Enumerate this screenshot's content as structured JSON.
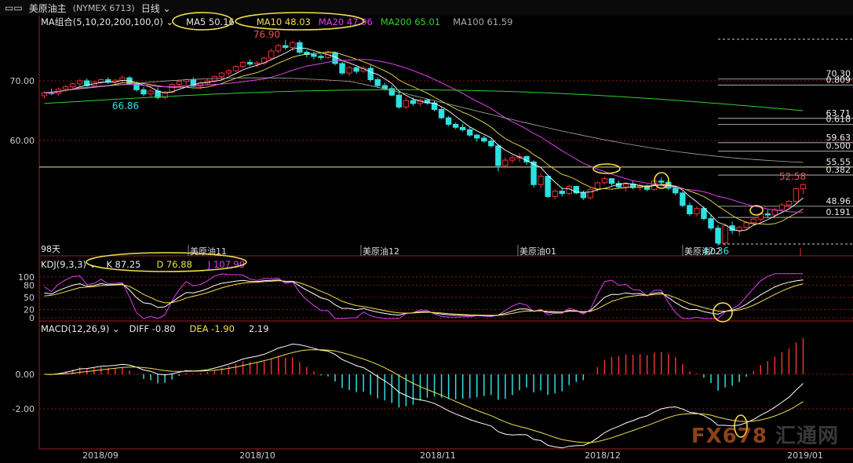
{
  "title": {
    "left_icon": "window-controls-icon",
    "name": "美原油主",
    "symbol": "(NYMEX 6713)",
    "period": "日线"
  },
  "ma": {
    "label": "MA组合(5,10,20,200,100,0)",
    "ma5": "MA5 50.16",
    "ma10": "MA10 48.03",
    "ma20": "MA20 47.96",
    "ma200": "MA200 65.01",
    "ma100": "MA100 61.59"
  },
  "kdj": {
    "label": "KDJ(9,3,3)",
    "k": "K 87.25",
    "d": "D 76.88",
    "j": "J 107.99",
    "ticks": [
      "100",
      "80",
      "50",
      "20",
      "0"
    ]
  },
  "macd": {
    "label": "MACD(12,26,9)",
    "diff": "DIFF -0.80",
    "dea": "DEA -1.90",
    "macd": "2.19",
    "ticks": [
      "0.00",
      "-2.00"
    ]
  },
  "price_axis": [
    "70.00",
    "60.00"
  ],
  "fib_labels": [
    {
      "label": "70.30",
      "value": 70.3
    },
    {
      "label": "0.809",
      "value": 69.3
    },
    {
      "label": "63.71",
      "value": 63.71
    },
    {
      "label": "0.618",
      "value": 62.7
    },
    {
      "label": "59.63",
      "value": 59.63
    },
    {
      "label": "0.500",
      "value": 58.2
    },
    {
      "label": "55.55",
      "value": 55.55
    },
    {
      "label": "0.382",
      "value": 54.2
    },
    {
      "label": "48.96",
      "value": 48.96
    },
    {
      "label": "0.191",
      "value": 47.1
    }
  ],
  "annotations": {
    "high": "76.90",
    "low1": "66.86",
    "last": "52.58",
    "low2": "42.36",
    "days": "98天"
  },
  "contract_labels": [
    "美原油11",
    "美原油12",
    "美原油01",
    "美原油02"
  ],
  "x_labels": [
    "2018/09",
    "2018/10",
    "2018/11",
    "2018/12",
    "2019/01"
  ],
  "watermark": {
    "a": "FX678",
    "b": "汇通网"
  },
  "chart_data": {
    "type": "candlestick",
    "title": "美原油主 (NYMEX 6713) 日线",
    "ylim": [
      40,
      80
    ],
    "series": [
      {
        "name": "MA5",
        "value": 50.16
      },
      {
        "name": "MA10",
        "value": 48.03
      },
      {
        "name": "MA20",
        "value": 47.96
      },
      {
        "name": "MA200",
        "value": 65.01
      },
      {
        "name": "MA100",
        "value": 61.59
      }
    ],
    "candles": [
      [
        67.5,
        68.2,
        67.0,
        68.0
      ],
      [
        68.0,
        68.7,
        67.6,
        67.9
      ],
      [
        67.9,
        68.9,
        67.5,
        68.6
      ],
      [
        68.6,
        69.3,
        68.2,
        69.0
      ],
      [
        69.0,
        69.7,
        68.6,
        69.5
      ],
      [
        69.5,
        70.3,
        69.1,
        70.0
      ],
      [
        70.0,
        70.4,
        69.0,
        69.2
      ],
      [
        69.2,
        70.0,
        68.8,
        69.8
      ],
      [
        69.8,
        70.4,
        69.5,
        70.2
      ],
      [
        70.2,
        70.6,
        69.5,
        69.8
      ],
      [
        69.8,
        70.3,
        69.2,
        70.1
      ],
      [
        70.1,
        70.9,
        69.7,
        70.5
      ],
      [
        70.5,
        70.8,
        69.3,
        69.5
      ],
      [
        69.5,
        69.9,
        68.2,
        68.5
      ],
      [
        68.5,
        69.0,
        67.4,
        67.8
      ],
      [
        67.8,
        68.6,
        67.2,
        68.3
      ],
      [
        68.3,
        68.9,
        66.9,
        67.2
      ],
      [
        67.2,
        68.3,
        66.9,
        68.1
      ],
      [
        68.1,
        69.6,
        67.9,
        69.4
      ],
      [
        69.4,
        70.2,
        69.0,
        69.9
      ],
      [
        69.9,
        70.4,
        69.3,
        70.2
      ],
      [
        70.2,
        70.6,
        69.0,
        69.1
      ],
      [
        69.1,
        69.8,
        68.6,
        69.6
      ],
      [
        69.6,
        70.3,
        69.2,
        70.0
      ],
      [
        70.0,
        70.9,
        69.8,
        70.7
      ],
      [
        70.7,
        71.5,
        70.1,
        71.3
      ],
      [
        71.3,
        72.0,
        70.9,
        71.7
      ],
      [
        71.7,
        72.6,
        71.4,
        72.4
      ],
      [
        72.4,
        73.3,
        72.1,
        73.1
      ],
      [
        73.1,
        73.6,
        72.5,
        72.8
      ],
      [
        72.8,
        73.4,
        72.2,
        73.0
      ],
      [
        73.0,
        74.0,
        72.6,
        73.8
      ],
      [
        73.8,
        75.4,
        73.5,
        75.0
      ],
      [
        75.0,
        76.2,
        74.6,
        75.9
      ],
      [
        75.9,
        76.9,
        75.2,
        75.6
      ],
      [
        75.6,
        76.7,
        75.0,
        76.4
      ],
      [
        76.4,
        76.8,
        74.5,
        74.8
      ],
      [
        74.8,
        75.2,
        73.9,
        74.4
      ],
      [
        74.4,
        74.9,
        73.6,
        74.1
      ],
      [
        74.1,
        74.5,
        73.5,
        73.9
      ],
      [
        73.9,
        75.1,
        73.6,
        74.7
      ],
      [
        74.7,
        74.9,
        72.6,
        72.9
      ],
      [
        72.9,
        73.2,
        71.0,
        71.3
      ],
      [
        71.3,
        72.5,
        70.8,
        72.2
      ],
      [
        72.2,
        72.4,
        71.2,
        71.6
      ],
      [
        71.6,
        72.5,
        71.3,
        72.1
      ],
      [
        72.1,
        72.6,
        69.8,
        70.2
      ],
      [
        70.2,
        70.6,
        68.8,
        69.2
      ],
      [
        69.2,
        69.7,
        68.4,
        68.7
      ],
      [
        68.7,
        69.2,
        67.4,
        67.6
      ],
      [
        67.6,
        68.1,
        65.3,
        65.6
      ],
      [
        65.6,
        67.1,
        65.2,
        66.7
      ],
      [
        66.7,
        67.2,
        65.8,
        66.2
      ],
      [
        66.2,
        67.0,
        65.7,
        66.8
      ],
      [
        66.8,
        67.0,
        66.0,
        66.3
      ],
      [
        66.3,
        66.7,
        64.9,
        65.2
      ],
      [
        65.2,
        65.6,
        63.6,
        63.8
      ],
      [
        63.8,
        64.1,
        62.4,
        62.7
      ],
      [
        62.7,
        63.0,
        61.9,
        62.2
      ],
      [
        62.2,
        62.8,
        61.5,
        61.8
      ],
      [
        61.8,
        62.2,
        60.6,
        60.9
      ],
      [
        60.9,
        61.1,
        59.8,
        60.4
      ],
      [
        60.4,
        60.8,
        59.6,
        59.9
      ],
      [
        59.9,
        60.3,
        58.8,
        59.1
      ],
      [
        59.1,
        59.4,
        54.8,
        55.8
      ],
      [
        55.8,
        57.2,
        55.3,
        56.7
      ],
      [
        56.7,
        57.5,
        56.2,
        57.1
      ],
      [
        57.1,
        57.9,
        56.4,
        57.3
      ],
      [
        57.3,
        57.5,
        55.9,
        56.4
      ],
      [
        56.4,
        56.7,
        52.1,
        52.6
      ],
      [
        52.6,
        54.4,
        52.0,
        54.0
      ],
      [
        54.0,
        54.3,
        50.4,
        50.6
      ],
      [
        50.6,
        51.8,
        50.1,
        51.5
      ],
      [
        51.5,
        52.1,
        50.6,
        51.1
      ],
      [
        51.1,
        52.6,
        50.8,
        52.3
      ],
      [
        52.3,
        52.4,
        51.0,
        51.2
      ],
      [
        51.2,
        51.6,
        50.0,
        50.4
      ],
      [
        50.4,
        52.0,
        50.1,
        51.8
      ],
      [
        51.8,
        53.1,
        51.4,
        52.9
      ],
      [
        52.9,
        53.9,
        52.6,
        53.6
      ],
      [
        53.6,
        53.7,
        52.4,
        52.8
      ],
      [
        52.8,
        53.3,
        52.0,
        52.2
      ],
      [
        52.2,
        53.0,
        51.4,
        52.7
      ],
      [
        52.7,
        53.2,
        51.8,
        52.1
      ],
      [
        52.1,
        52.8,
        51.6,
        52.4
      ],
      [
        52.4,
        52.6,
        51.5,
        51.8
      ],
      [
        51.8,
        53.6,
        51.5,
        53.2
      ],
      [
        53.2,
        53.8,
        52.6,
        53.0
      ],
      [
        53.0,
        53.5,
        51.7,
        52.0
      ],
      [
        52.0,
        52.4,
        50.8,
        51.2
      ],
      [
        51.2,
        51.5,
        48.8,
        49.1
      ],
      [
        49.1,
        49.6,
        47.3,
        47.7
      ],
      [
        47.7,
        48.9,
        47.2,
        48.6
      ],
      [
        48.6,
        49.0,
        46.6,
        46.9
      ],
      [
        46.9,
        47.5,
        44.9,
        45.3
      ],
      [
        45.3,
        45.8,
        42.4,
        42.8
      ],
      [
        42.8,
        46.1,
        42.4,
        45.7
      ],
      [
        45.7,
        46.4,
        44.3,
        44.9
      ],
      [
        44.9,
        45.7,
        44.0,
        45.4
      ],
      [
        45.4,
        46.5,
        45.0,
        46.2
      ],
      [
        46.2,
        47.1,
        45.7,
        46.8
      ],
      [
        46.8,
        48.0,
        46.4,
        47.7
      ],
      [
        47.7,
        48.4,
        47.0,
        47.5
      ],
      [
        47.5,
        48.7,
        47.2,
        48.4
      ],
      [
        48.4,
        49.5,
        48.1,
        49.2
      ],
      [
        49.2,
        50.0,
        48.7,
        49.8
      ],
      [
        49.8,
        52.1,
        49.5,
        51.9
      ],
      [
        51.9,
        52.8,
        51.0,
        52.6
      ]
    ]
  }
}
